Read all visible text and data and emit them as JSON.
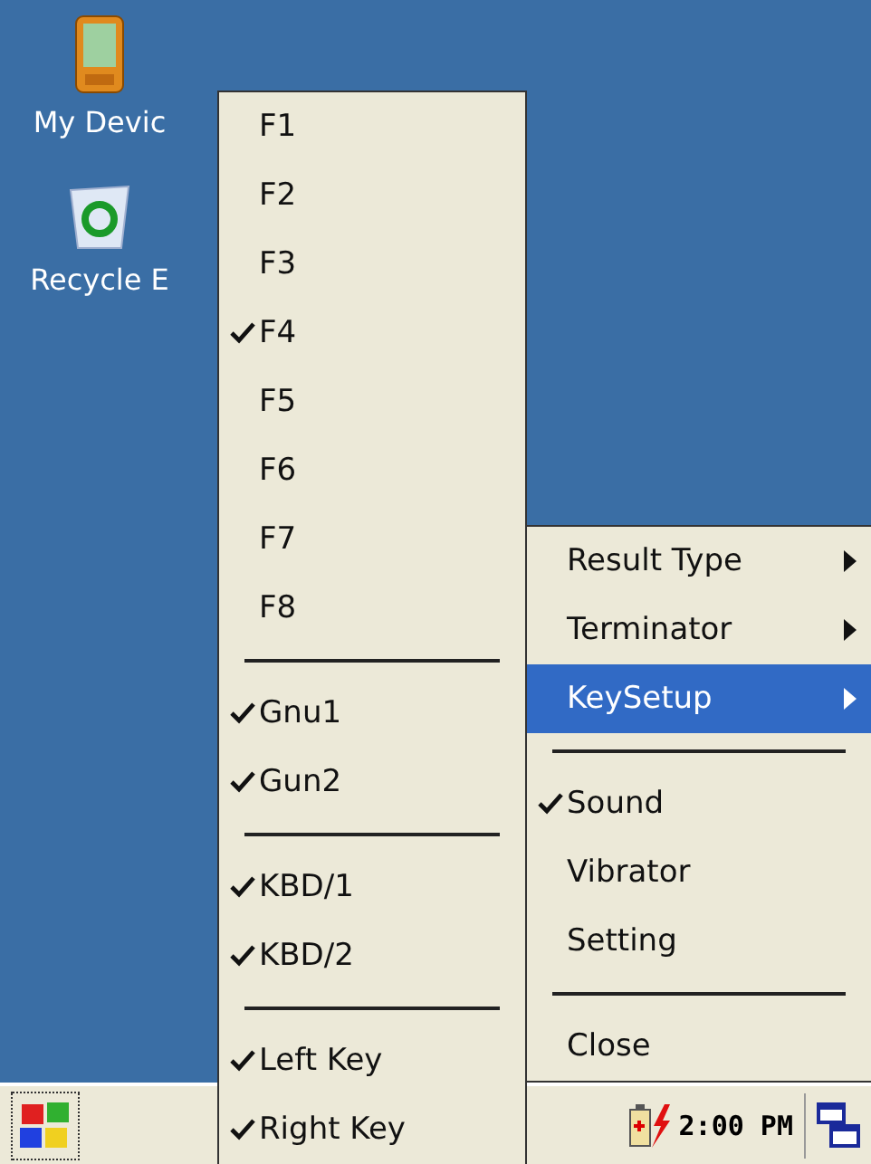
{
  "desktop_icons": [
    {
      "kind": "device",
      "label": "My Devic"
    },
    {
      "kind": "recycle",
      "label": "Recycle E"
    }
  ],
  "key_menu": {
    "items": [
      {
        "kind": "item",
        "label": "F1",
        "checked": false
      },
      {
        "kind": "item",
        "label": "F2",
        "checked": false
      },
      {
        "kind": "item",
        "label": "F3",
        "checked": false
      },
      {
        "kind": "item",
        "label": "F4",
        "checked": true
      },
      {
        "kind": "item",
        "label": "F5",
        "checked": false
      },
      {
        "kind": "item",
        "label": "F6",
        "checked": false
      },
      {
        "kind": "item",
        "label": "F7",
        "checked": false
      },
      {
        "kind": "item",
        "label": "F8",
        "checked": false
      },
      {
        "kind": "separator"
      },
      {
        "kind": "item",
        "label": "Gnu1",
        "checked": true
      },
      {
        "kind": "item",
        "label": "Gun2",
        "checked": true
      },
      {
        "kind": "separator"
      },
      {
        "kind": "item",
        "label": "KBD/1",
        "checked": true
      },
      {
        "kind": "item",
        "label": "KBD/2",
        "checked": true
      },
      {
        "kind": "separator"
      },
      {
        "kind": "item",
        "label": "Left Key",
        "checked": true
      },
      {
        "kind": "item",
        "label": "Right Key",
        "checked": true
      }
    ]
  },
  "main_menu": {
    "items": [
      {
        "kind": "submenu",
        "label": "Result Type",
        "checked": false,
        "selected": false
      },
      {
        "kind": "submenu",
        "label": "Terminator",
        "checked": false,
        "selected": false
      },
      {
        "kind": "submenu",
        "label": "KeySetup",
        "checked": false,
        "selected": true
      },
      {
        "kind": "separator"
      },
      {
        "kind": "item",
        "label": "Sound",
        "checked": true,
        "selected": false
      },
      {
        "kind": "item",
        "label": "Vibrator",
        "checked": false,
        "selected": false
      },
      {
        "kind": "item",
        "label": "Setting",
        "checked": false,
        "selected": false
      },
      {
        "kind": "separator"
      },
      {
        "kind": "item",
        "label": "Close",
        "checked": false,
        "selected": false
      }
    ]
  },
  "taskbar": {
    "clock": "2:00 PM"
  }
}
